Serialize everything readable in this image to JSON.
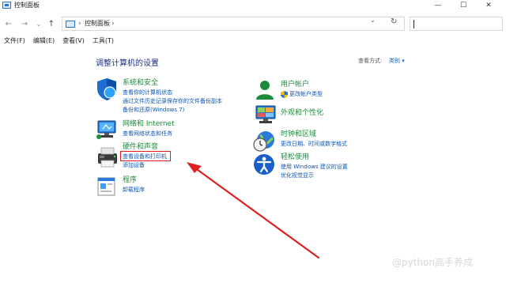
{
  "window": {
    "title": "控制面板"
  },
  "window_controls": {
    "minimize": "—",
    "maximize": "☐",
    "close": "✕"
  },
  "nav": {
    "back": "←",
    "forward": "→",
    "dropdown": "⌄",
    "up": "↑"
  },
  "address": {
    "separator": "›",
    "path": "控制面板",
    "trailing": "›",
    "dropdown": "⌄",
    "refresh": "↻"
  },
  "search": {
    "placeholder": ""
  },
  "menu": [
    "文件(F)",
    "编辑(E)",
    "查看(V)",
    "工具(T)"
  ],
  "main": {
    "heading": "调整计算机的设置",
    "view_by_label": "查看方式:",
    "view_by_value": "类别 ▾"
  },
  "categories_left": [
    {
      "title": "系统和安全",
      "links": [
        "查看你的计算机状态",
        "通过文件历史记录保存你的文件备份副本",
        "备份和还原(Windows 7)"
      ]
    },
    {
      "title": "网络和 Internet",
      "links": [
        "查看网络状态和任务"
      ]
    },
    {
      "title": "硬件和声音",
      "links": [
        "查看设备和打印机",
        "添加设备"
      ]
    },
    {
      "title": "程序",
      "links": [
        "卸载程序"
      ]
    }
  ],
  "categories_right": [
    {
      "title": "用户帐户",
      "links": [
        "更改帐户类型"
      ]
    },
    {
      "title": "外观和个性化",
      "links": []
    },
    {
      "title": "时钟和区域",
      "links": [
        "更改日期、时间或数字格式"
      ]
    },
    {
      "title": "轻松使用",
      "links": [
        "使用 Windows 建议的设置",
        "优化视觉显示"
      ]
    }
  ],
  "watermark": "@python高手养成",
  "colors": {
    "category_title": "#1c8b3a",
    "link": "#0a56b8",
    "heading": "#1e3287",
    "annotation": "#e02020"
  }
}
